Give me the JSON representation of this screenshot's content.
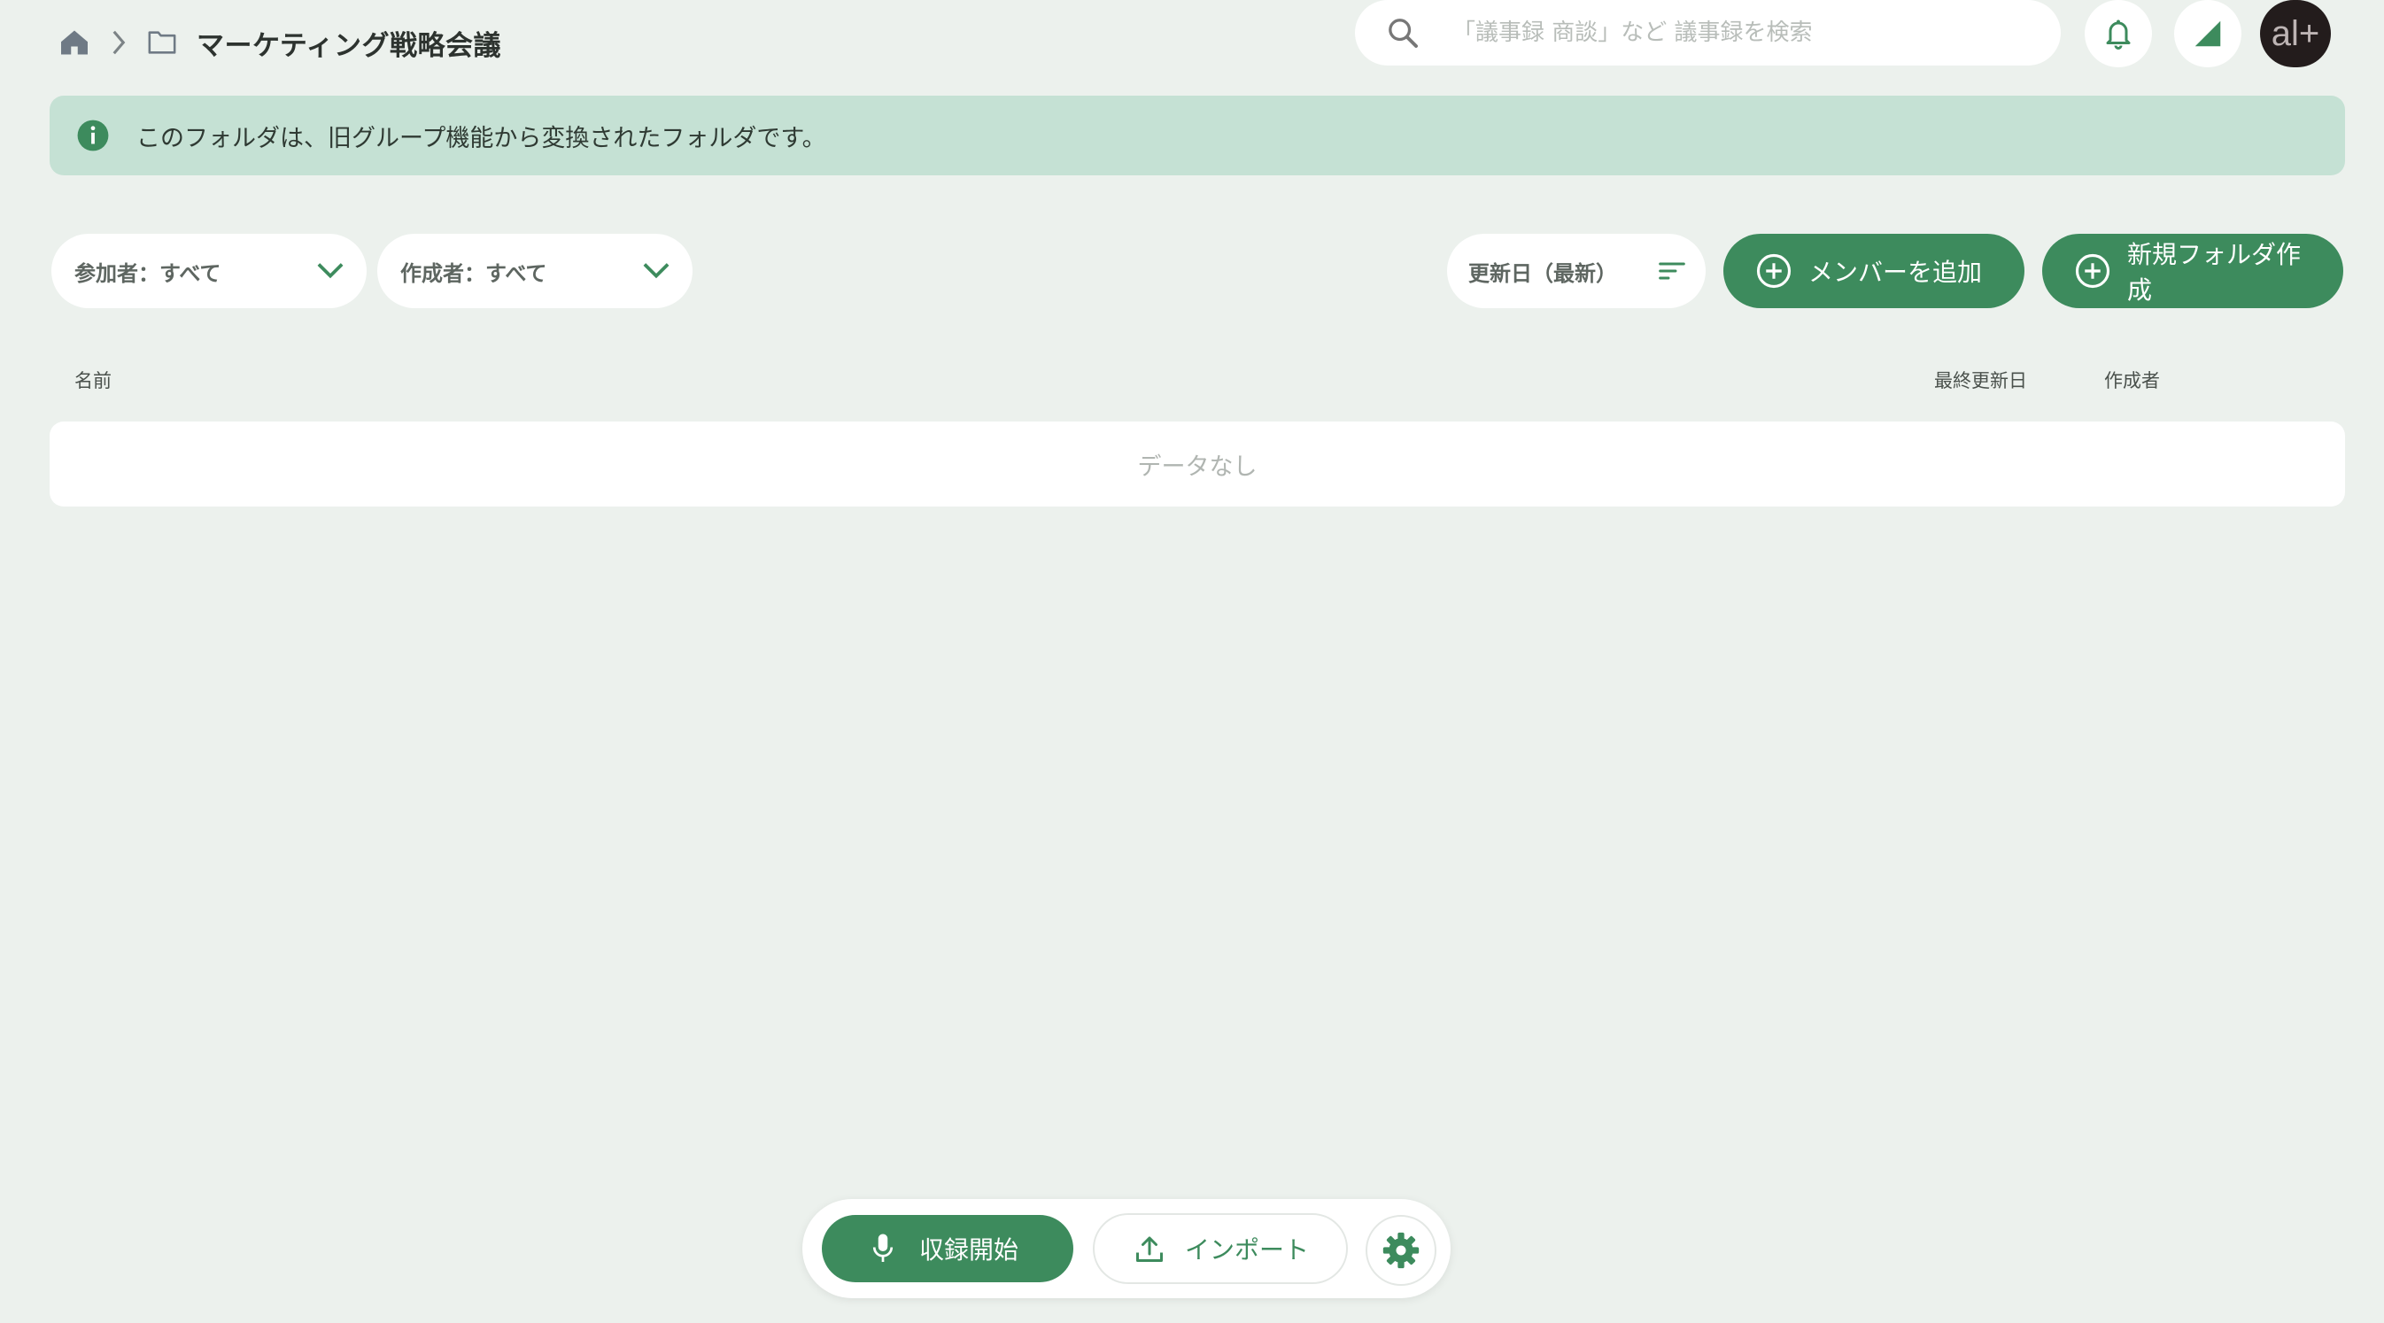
{
  "header": {
    "breadcrumb": {
      "home_icon": "home-icon",
      "separator_icon": "chevron-right-icon",
      "folder_icon": "folder-icon",
      "title": "マーケティング戦略会議"
    },
    "search": {
      "placeholder": "「議事録 商談」など 議事録を検索",
      "value": "",
      "icon": "search-icon"
    },
    "actions": {
      "notifications_icon": "bell-icon",
      "signal_icon": "signal-icon",
      "avatar_text": "al+"
    }
  },
  "banner": {
    "icon": "info-icon",
    "text": "このフォルダは、旧グループ機能から変換されたフォルダです。"
  },
  "filters": {
    "participants_label": "参加者：すべて",
    "author_label": "作成者：すべて",
    "sort_label": "更新日（最新）"
  },
  "buttons": {
    "add_member": "メンバーを追加",
    "new_folder": "新規フォルダ作成"
  },
  "table": {
    "columns": [
      "名前",
      "最終更新日",
      "作成者"
    ],
    "empty_text": "データなし"
  },
  "bottom_bar": {
    "record": "収録開始",
    "import": "インポート",
    "settings_icon": "gear-icon"
  },
  "colors": {
    "background": "#ecf1ed",
    "accent": "#3d8b5d",
    "banner": "#c5e1d4",
    "avatar": "#231c1c"
  }
}
